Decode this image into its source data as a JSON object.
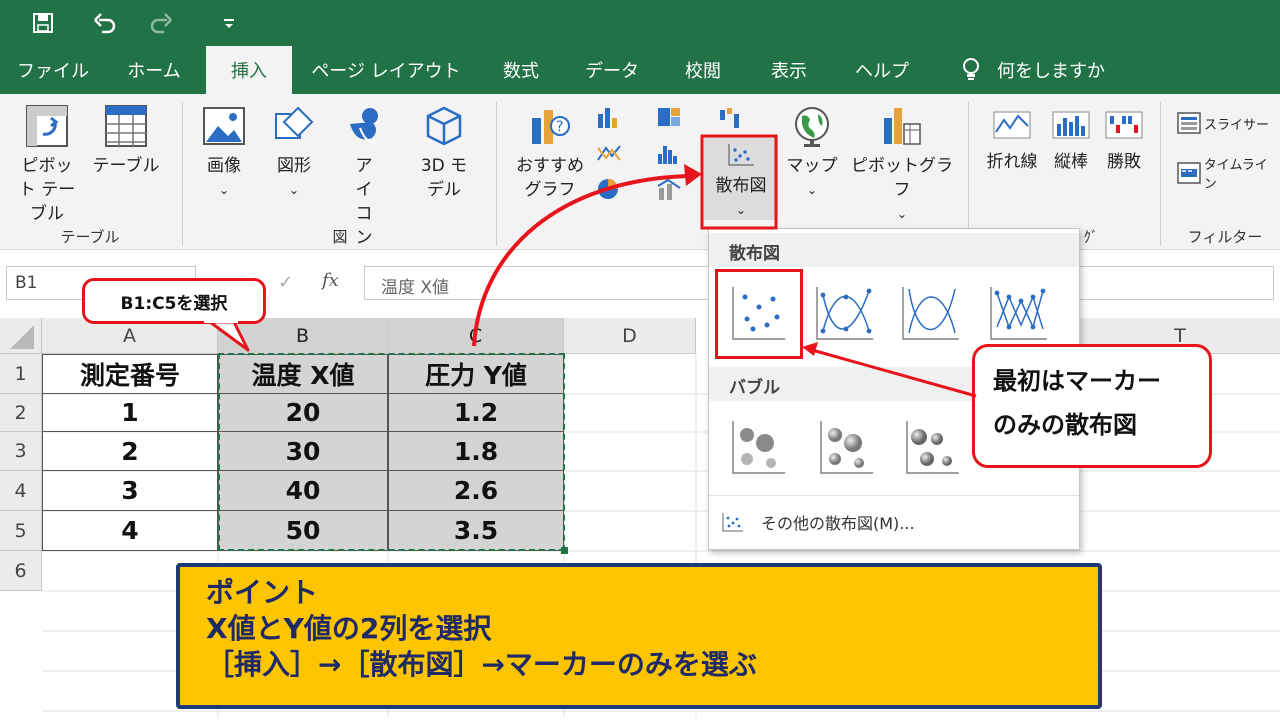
{
  "quick_access": {
    "save_icon": "save-icon",
    "undo_icon": "undo-icon",
    "redo_icon": "redo-icon",
    "customize_icon": "customize-icon"
  },
  "tabs": [
    "ファイル",
    "ホーム",
    "挿入",
    "ページ レイアウト",
    "数式",
    "データ",
    "校閲",
    "表示",
    "ヘルプ"
  ],
  "active_tab": "挿入",
  "tell_me": "何をしますか",
  "ribbon": {
    "pivot_table": "ピボット テーブル",
    "table": "テーブル",
    "group_table": "テーブル",
    "image": "画像",
    "shapes": "図形",
    "icons": "アイ コン",
    "model3d": "3D モデル",
    "group_illustrations": "図",
    "recommended_charts": "おすすめ グラフ",
    "scatter": "散布図",
    "maps": "マップ",
    "pivot_chart": "ピボットグラフ",
    "sparkline_line": "折れ線",
    "sparkline_column": "縦棒",
    "sparkline_winloss": "勝敗",
    "group_sparklines_partial": "ｸﾞ",
    "slicer": "スライサー",
    "timeline": "タイムライン",
    "group_filter": "フィルター"
  },
  "formula_bar": {
    "name_box": "B1",
    "fx": "fx",
    "content": "温度 X値"
  },
  "columns": [
    "A",
    "B",
    "C",
    "D",
    "T"
  ],
  "rows": [
    "1",
    "2",
    "3",
    "4",
    "5",
    "6"
  ],
  "table": {
    "headers": [
      "測定番号",
      "温度 X値",
      "圧力 Y値"
    ],
    "data": [
      [
        "1",
        "20",
        "1.2"
      ],
      [
        "2",
        "30",
        "1.8"
      ],
      [
        "3",
        "40",
        "2.6"
      ],
      [
        "4",
        "50",
        "3.5"
      ]
    ]
  },
  "dropdown": {
    "section_scatter": "散布図",
    "section_bubble": "バブル",
    "more": "その他の散布図(M)..."
  },
  "callouts": {
    "range": "B1:C5を選択",
    "marker_only_line1": "最初はマーカー",
    "marker_only_line2": "のみの散布図"
  },
  "point": {
    "title": "ポイント",
    "line1": "X値とY値の2列を選択",
    "line2": "［挿入］→［散布図］→マーカーのみを選ぶ"
  },
  "colors": {
    "excel_green": "#217346",
    "callout_red": "#e8141b",
    "point_yellow": "#fdc500",
    "point_navy": "#1f3a78"
  }
}
